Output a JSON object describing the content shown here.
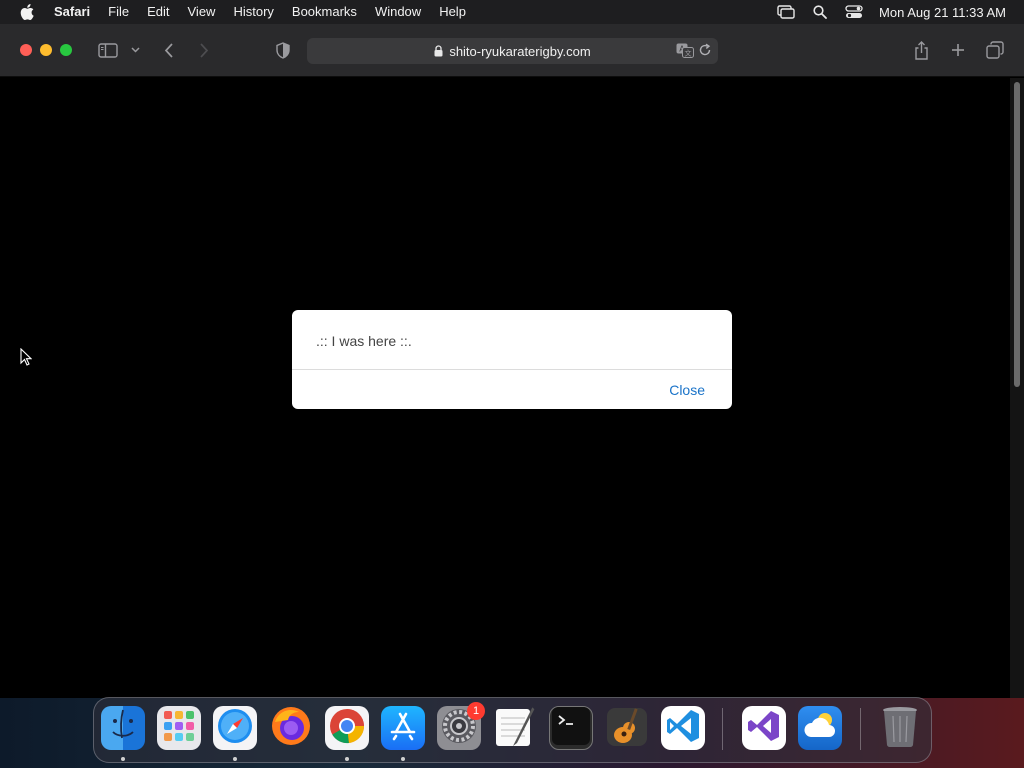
{
  "menubar": {
    "apple_icon": "apple-logo",
    "items": [
      "Safari",
      "File",
      "Edit",
      "View",
      "History",
      "Bookmarks",
      "Window",
      "Help"
    ],
    "status_icons": [
      "screen-mirroring-icon",
      "spotlight-search-icon",
      "control-center-icon"
    ],
    "clock": "Mon Aug 21  11:33 AM"
  },
  "browser": {
    "url": "shito-ryukaraterigby.com",
    "toolbar_icons": [
      "sidebar-icon",
      "chevron-down-icon",
      "back-icon",
      "forward-icon",
      "privacy-shield-icon",
      "share-icon",
      "new-tab-icon",
      "tab-overview-icon"
    ],
    "address_icons": [
      "lock-icon",
      "translate-icon",
      "reload-icon"
    ]
  },
  "dialog": {
    "message": ".:: I was here ::.",
    "close_label": "Close"
  },
  "dock": {
    "apps": [
      "Finder",
      "Launchpad",
      "Safari",
      "Firefox",
      "Google Chrome",
      "App Store",
      "System Settings",
      "TextEdit",
      "Terminal",
      "GarageBand",
      "Visual Studio Code",
      "Visual Studio",
      "Weather",
      "Trash"
    ],
    "system_settings_badge": "1"
  },
  "colors": {
    "dialog_link": "#1a73c8",
    "traffic_red": "#ff5f57",
    "traffic_yellow": "#febc2e",
    "traffic_green": "#28c840",
    "badge": "#ff3b30"
  }
}
